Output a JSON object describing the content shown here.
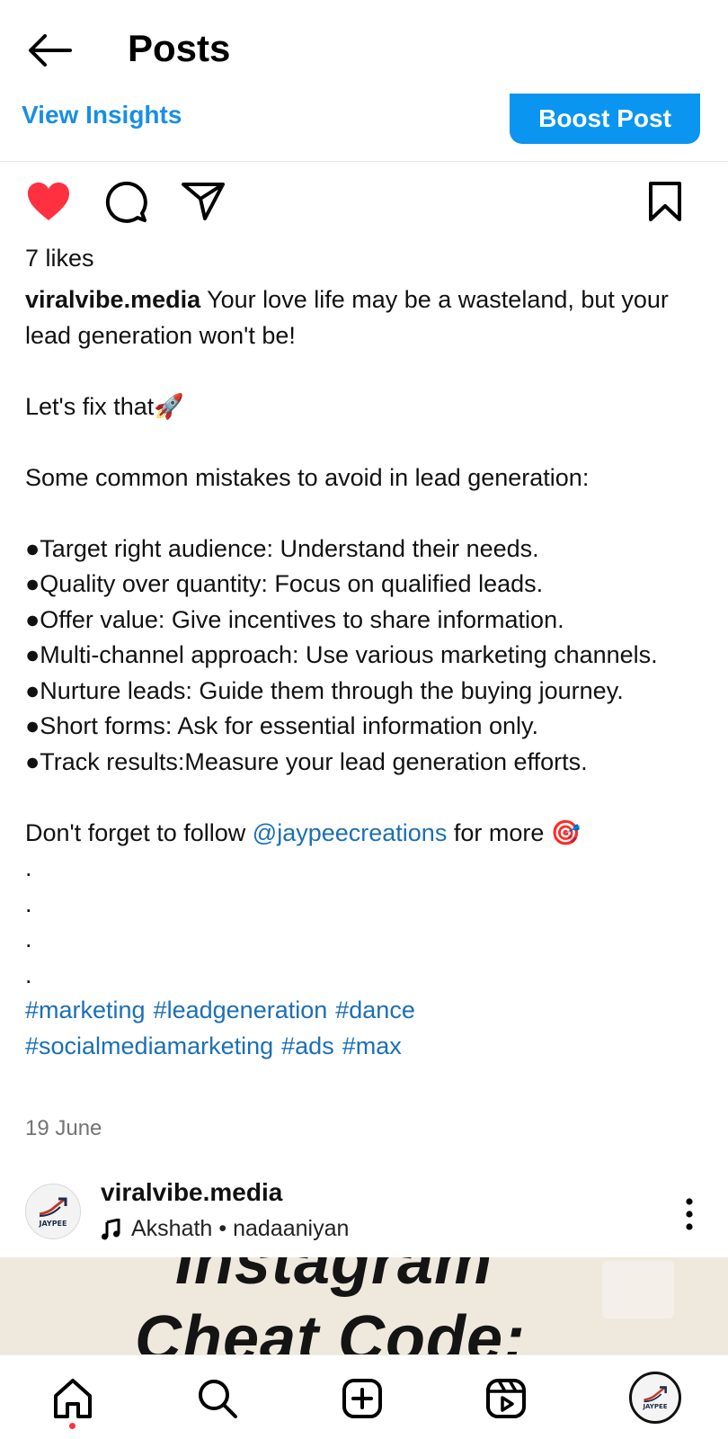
{
  "header": {
    "title": "Posts",
    "back_icon": "arrow-left-icon"
  },
  "insights": {
    "view_insights_label": "View Insights",
    "boost_label": "Boost Post",
    "boost_color": "#0a95f0",
    "link_color": "#1a8ee6"
  },
  "actions": {
    "like_icon": "heart-filled-icon",
    "like_color": "#ff3040",
    "comment_icon": "comment-icon",
    "share_icon": "send-icon",
    "save_icon": "bookmark-icon"
  },
  "post": {
    "likes": "7 likes",
    "username": "viralvibe.media",
    "caption_first": " Your love life may be a wasteland, but your lead generation won't be!",
    "fix_line": "Let's fix that🚀",
    "intro_line": "Some common mistakes to avoid in lead generation:",
    "bullets": [
      "●Target right audience: Understand their needs.",
      "●Quality over quantity: Focus on qualified leads.",
      "●Offer value: Give incentives to share information.",
      "●Multi-channel approach: Use various marketing channels.",
      "●Nurture leads: Guide them through the buying journey.",
      "●Short forms: Ask for essential information only.",
      "●Track results:Measure your lead generation efforts."
    ],
    "follow_prefix": "Don't forget to follow ",
    "follow_handle": "@jaypeecreations",
    "follow_suffix": " for more 🎯",
    "dots": [
      ".",
      ".",
      ".",
      "."
    ],
    "hashtags": [
      "#marketing",
      "#leadgeneration",
      "#dance",
      "#socialmediamarketing",
      "#ads",
      "#max"
    ],
    "date": "19 June"
  },
  "next_post": {
    "username": "viralvibe.media",
    "audio_artist": "Akshath",
    "audio_separator": "•",
    "audio_track": "nadaaniyan",
    "avatar_text": "JAYPEE",
    "image_line1": "Instagram",
    "image_line2": "Cheat Code:"
  },
  "bottom_nav": {
    "items": [
      "home-icon",
      "search-icon",
      "create-icon",
      "reels-icon",
      "profile-avatar"
    ],
    "avatar_text": "JAYPEE",
    "notification_color": "#ff3040"
  }
}
